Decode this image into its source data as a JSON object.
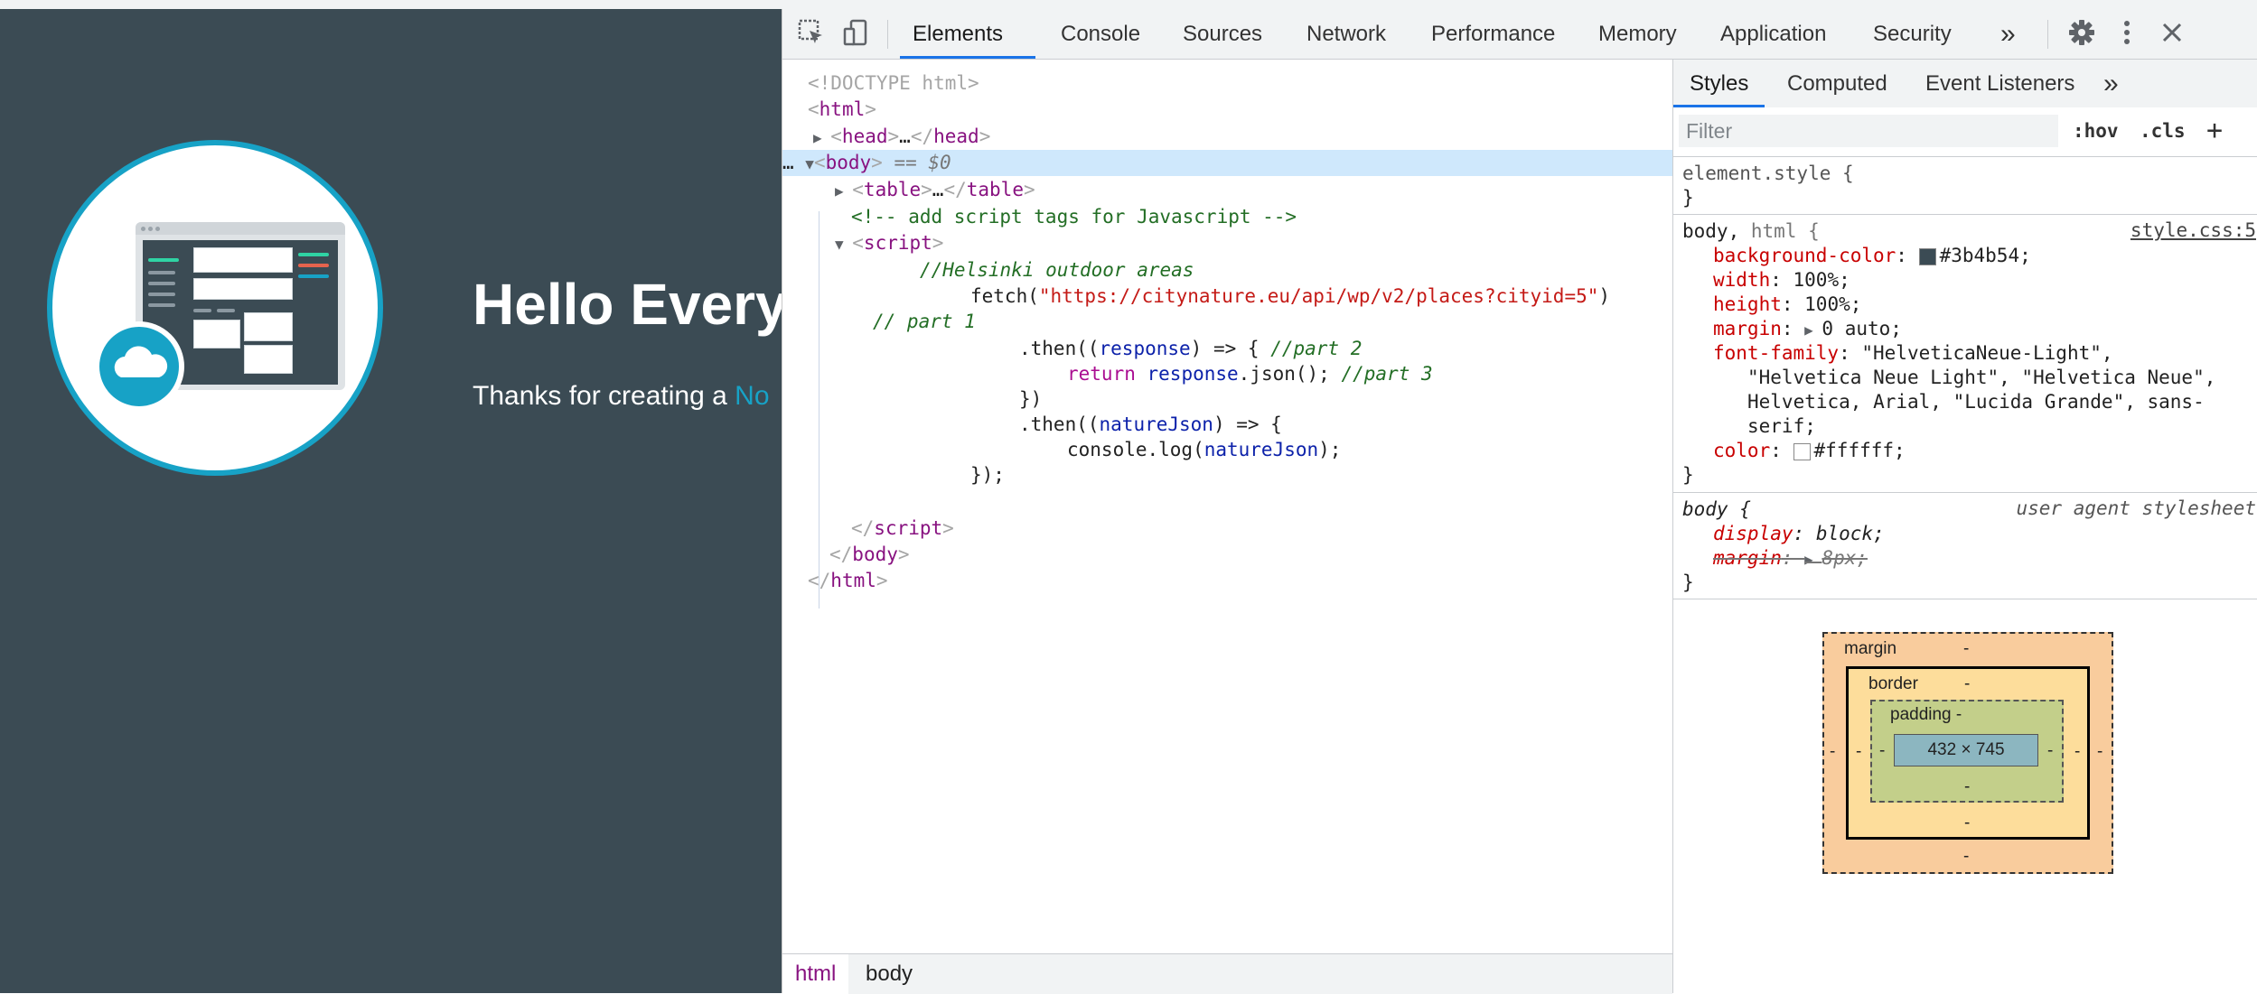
{
  "webpage": {
    "heading": "Hello Every",
    "subtitle_prefix": "Thanks for creating a ",
    "subtitle_link": "No",
    "colors": {
      "background": "#3b4b54",
      "accent": "#17a2c6"
    }
  },
  "devtools": {
    "tabs": [
      "Elements",
      "Console",
      "Sources",
      "Network",
      "Performance",
      "Memory",
      "Application",
      "Security"
    ],
    "active_tab": "Elements",
    "more_tabs_icon": "»",
    "elements_tree": {
      "doctype": "<!DOCTYPE html>",
      "html_open": "html",
      "head": "head",
      "head_ellipsis": "…",
      "body": "body",
      "selected_marker": "== $0",
      "table": "table",
      "table_ellipsis": "…",
      "comment": "<!-- add script tags for Javascript -->",
      "script": "script",
      "code_comment_1": "//Helsinki outdoor areas",
      "fetch_fn": "fetch(",
      "fetch_url": "\"https://citynature.eu/api/wp/v2/places?cityid=5\"",
      "fetch_close": ")",
      "part1_comment": "// part 1",
      "then1_open": ".then((",
      "then1_param": "response",
      "then1_arrow": ") => {",
      "part2_comment": "//part 2",
      "return_kw": "return",
      "return_expr": "response",
      "return_call": ".json();",
      "part3_comment": "//part 3",
      "close_paren": "})",
      "then2_open": ".then((",
      "then2_param": "natureJson",
      "then2_arrow": ") => {",
      "console_log": "console.log(",
      "console_arg": "natureJson",
      "console_close": ");",
      "final_close": "});",
      "script_close": "script",
      "body_close": "body",
      "html_close": "html"
    },
    "breadcrumbs": [
      "html",
      "body"
    ],
    "styles_pane": {
      "tabs": [
        "Styles",
        "Computed",
        "Event Listeners"
      ],
      "active_tab": "Styles",
      "filter_placeholder": "Filter",
      "hov": ":hov",
      "cls": ".cls",
      "add": "+",
      "element_style": "element.style {",
      "close_brace": "}",
      "rule1": {
        "selector_main": "body,",
        "selector_dim": " html {",
        "source": "style.css:5",
        "props": [
          {
            "name": "background-color",
            "value": "#3b4b54",
            "swatch": "#3b4b54"
          },
          {
            "name": "width",
            "value": "100%;"
          },
          {
            "name": "height",
            "value": "100%;"
          },
          {
            "name": "margin",
            "value": "0 auto;"
          },
          {
            "name": "font-family",
            "value": "\"HelveticaNeue-Light\","
          },
          {
            "name": "",
            "value": "\"Helvetica Neue Light\", \"Helvetica Neue\","
          },
          {
            "name": "",
            "value": "Helvetica, Arial, \"Lucida Grande\", sans-"
          },
          {
            "name": "",
            "value": "serif;"
          },
          {
            "name": "color",
            "value": "#ffffff;",
            "swatch": "#ffffff"
          }
        ]
      },
      "rule2": {
        "selector": "body {",
        "source": "user agent stylesheet",
        "props": [
          {
            "name": "display",
            "value": "block;"
          },
          {
            "name": "margin",
            "value": "8px;"
          }
        ]
      },
      "box_model": {
        "margin_label": "margin",
        "border_label": "border",
        "padding_label": "padding -",
        "content": "432 × 745",
        "dash": "-"
      }
    }
  }
}
